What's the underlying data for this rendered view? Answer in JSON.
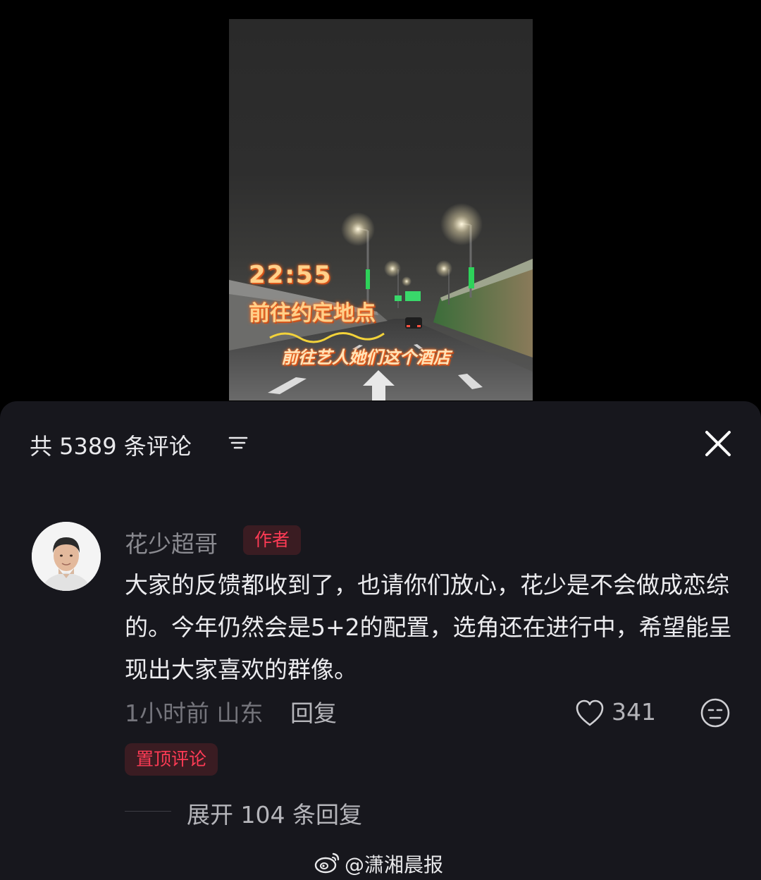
{
  "video": {
    "overlay_time": "22:55",
    "overlay_caption": "前往约定地点",
    "overlay_subcaption": "前往艺人她们这个酒店"
  },
  "comments_header": {
    "title": "共 5389 条评论",
    "filter_icon": "filter-icon",
    "close_icon": "close-icon"
  },
  "comment": {
    "author": "花少超哥",
    "badge": "作者",
    "content": "大家的反馈都收到了，也请你们放心，花少是不会做成恋综的。今年仍然会是5+2的配置，选角还在进行中，希望能呈现出大家喜欢的群像。",
    "time_location": "1小时前 山东",
    "reply_label": "回复",
    "like_count": "341",
    "pinned_label": "置顶评论",
    "expand_replies": "展开 104 条回复"
  },
  "watermark": {
    "text": "@潇湘晨报",
    "icon": "weibo-logo-icon"
  },
  "colors": {
    "sheet_bg": "#17171d",
    "accent_red": "#ff3b55",
    "overlay_text": "#ffd08a"
  }
}
